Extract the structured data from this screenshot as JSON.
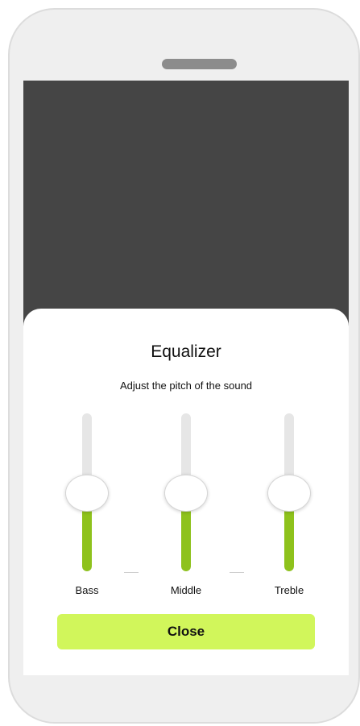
{
  "equalizer": {
    "title": "Equalizer",
    "subtitle": "Adjust the pitch of the sound",
    "sliders": [
      {
        "label": "Bass",
        "level": 0.5
      },
      {
        "label": "Middle",
        "level": 0.5
      },
      {
        "label": "Treble",
        "level": 0.5
      }
    ],
    "close_label": "Close"
  },
  "colors": {
    "phone_frame": "#efefef",
    "screen_overlay": "#454545",
    "slider_fill": "#8ec21c",
    "slider_track": "#e6e6e6",
    "close_button": "#d1f65b"
  }
}
